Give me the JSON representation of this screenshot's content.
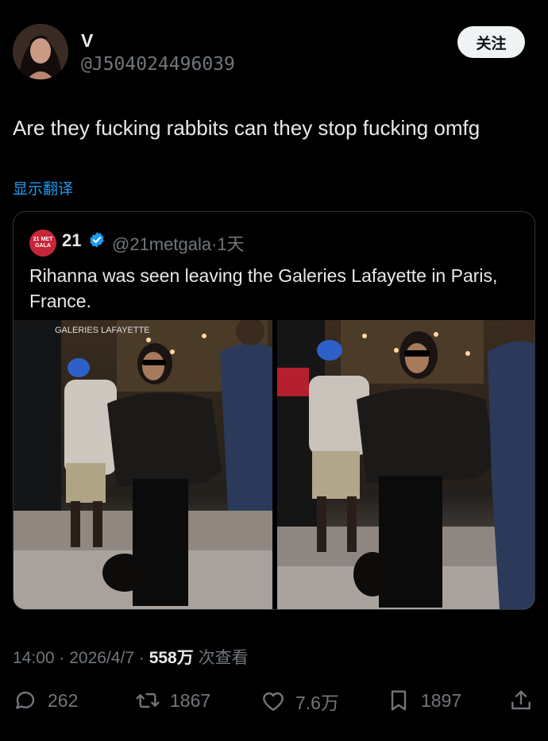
{
  "author": {
    "name": "V",
    "handle": "@J504024496039"
  },
  "follow_label": "关注",
  "tweet_text": "Are they fucking rabbits can they stop fucking omfg",
  "translate_label": "显示翻译",
  "quote": {
    "name": "21",
    "handle": "@21metgala",
    "separator": "·",
    "time": "1天",
    "avatar_text": "21 MET GALA",
    "text": "Rihanna was seen leaving the Galeries Lafayette in Paris, France.",
    "photo_signage": "GALERIES LAFAYETTE"
  },
  "meta": {
    "time": "14:00",
    "dot1": "·",
    "date": "2026/4/7",
    "dot2": "·",
    "views": "558万",
    "views_label": "次查看"
  },
  "actions": {
    "replies": "262",
    "reposts": "1867",
    "likes": "7.6万",
    "bookmarks": "1897"
  },
  "colors": {
    "background": "#000000",
    "accent": "#1d9bf0",
    "muted": "#71767b",
    "text": "#e7e9ea",
    "border": "#2f3336"
  },
  "icons": [
    "reply-icon",
    "repost-icon",
    "like-icon",
    "bookmark-icon",
    "share-icon",
    "verified-badge-icon"
  ]
}
